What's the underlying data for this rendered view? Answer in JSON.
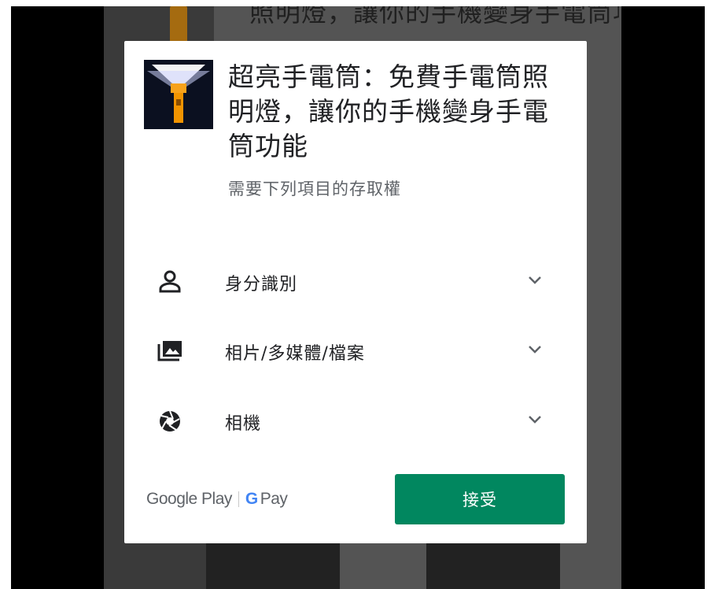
{
  "background": {
    "text": "照明燈，讓你的手機變身手電筒功能"
  },
  "app": {
    "title": "超亮手電筒：免費手電筒照明燈，讓你的手機變身手電筒功能",
    "subtitle": "需要下列項目的存取權",
    "icon": "flashlight-icon"
  },
  "permissions": [
    {
      "label": "身分識別",
      "icon": "person-icon"
    },
    {
      "label": "相片/多媒體/檔案",
      "icon": "photo-folder-icon"
    },
    {
      "label": "相機",
      "icon": "camera-aperture-icon"
    }
  ],
  "footer": {
    "google_play": "Google Play",
    "g_letter": "G",
    "pay": "Pay",
    "accept_label": "接受"
  },
  "colors": {
    "accept": "#01875f",
    "dialog_bg": "#ffffff",
    "overlay": "#545454"
  }
}
